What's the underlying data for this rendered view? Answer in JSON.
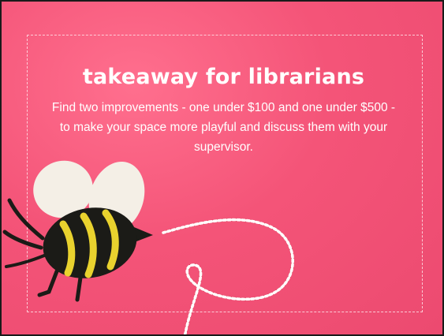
{
  "slide": {
    "title": "takeaway for librarians",
    "body": "Find two improvements - one under $100 and one under $500 - to make your space more playful and discuss them with your supervisor."
  },
  "colors": {
    "background": "#f25276",
    "text": "#ffffff",
    "bee_body": "#1b1b17",
    "bee_stripe": "#e9d22e",
    "bee_wing": "#f4efe6",
    "twine_red": "#c9243a",
    "twine_white": "#ffffff"
  },
  "illustration": {
    "bee": "felt-bee-icon",
    "twine": "bakers-twine-icon"
  }
}
